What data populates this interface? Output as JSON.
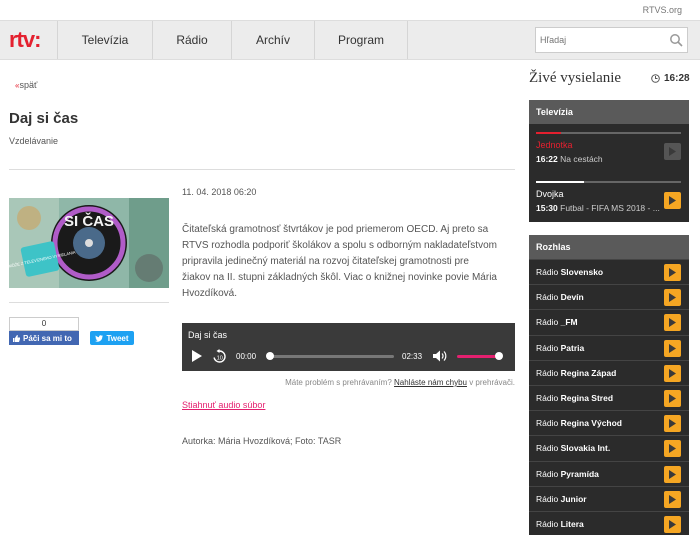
{
  "top": {
    "rtvs_link": "RTVS.org"
  },
  "header": {
    "logo": "rtv:",
    "nav": [
      {
        "label": "Televízia",
        "width": 95
      },
      {
        "label": "Rádio",
        "width": 79
      },
      {
        "label": "Archív",
        "width": 83
      },
      {
        "label": "Program",
        "width": 94
      }
    ],
    "search_placeholder": "Hľadaj"
  },
  "main": {
    "back": "späť",
    "title": "Daj si čas",
    "category": "Vzdelávanie",
    "date": "11. 04. 2018 06:20",
    "description": "Čitateľská gramotnosť štvrtákov je pod priemerom OECD. Aj preto sa RTVS rozhodla podporiť školákov a spolu s odborným nakladateľstvom pripravila jedinečný materiál na rozvoj čitateľskej gramotnosti pre žiakov na II. stupni základných škôl. Viac o knižnej novinke povie Mária Hvozdíková.",
    "thumb_text": "SI ČAS",
    "thumb_badge": "POMÔŽE Z TELEVÍZNEHO VYSIELANIA",
    "facebook": {
      "count": "0",
      "label": "Páči sa mi to"
    },
    "tweet": "Tweet",
    "player": {
      "title": "Daj si čas",
      "current": "00:00",
      "duration": "02:33",
      "progress": 0,
      "volume": 1.0
    },
    "problem": {
      "text": "Máte problém s prehrávaním?",
      "link": "Nahláste nám chybu",
      "suffix": "v prehrávači."
    },
    "download": "Stiahnuť audio súbor",
    "author": "Autorka: Mária Hvozdíková; Foto: TASR"
  },
  "sidebar": {
    "live_title": "Živé vysielanie",
    "time": "16:28",
    "tv": {
      "heading": "Televízia",
      "channels": [
        {
          "name": "Jednotka",
          "time": "16:22",
          "show": "Na cestách",
          "progress": 0.17,
          "active": false
        },
        {
          "name": "Dvojka",
          "time": "15:30",
          "show": "Futbal - FIFA MS 2018 - ...",
          "progress": 0.33,
          "active": true
        }
      ]
    },
    "radio": {
      "heading": "Rozhlas",
      "stations": [
        {
          "prefix": "Rádio",
          "name": "Slovensko"
        },
        {
          "prefix": "Rádio",
          "name": "Devín"
        },
        {
          "prefix": "Rádio",
          "name": "_FM"
        },
        {
          "prefix": "Rádio",
          "name": "Patria"
        },
        {
          "prefix": "Rádio",
          "name": "Regina Západ"
        },
        {
          "prefix": "Rádio",
          "name": "Regina Stred"
        },
        {
          "prefix": "Rádio",
          "name": "Regina Východ"
        },
        {
          "prefix": "Rádio",
          "name": "Slovakia Int."
        },
        {
          "prefix": "Rádio",
          "name": "Pyramída"
        },
        {
          "prefix": "Rádio",
          "name": "Junior"
        },
        {
          "prefix": "Rádio",
          "name": "Litera"
        }
      ]
    },
    "colors": {
      "accent": "#e4202f",
      "play": "#f5a623",
      "inactive_play": "#555555"
    }
  }
}
